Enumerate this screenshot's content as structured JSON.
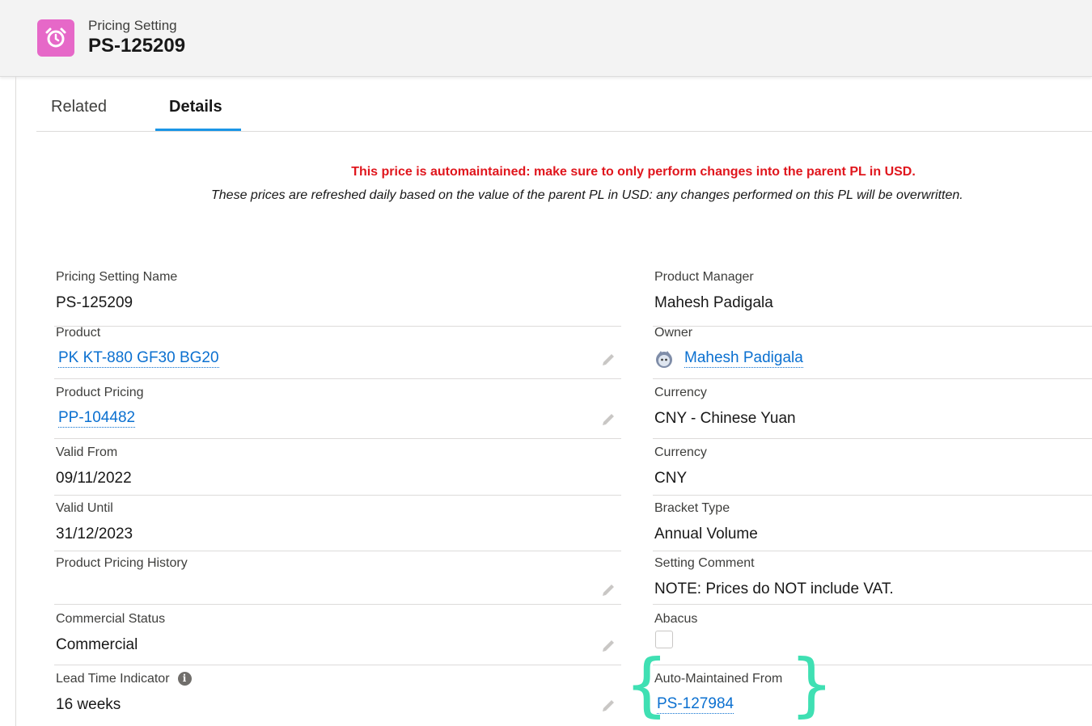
{
  "header": {
    "object_type": "Pricing Setting",
    "record_name": "PS-125209",
    "icon": "alarm-clock-icon",
    "icon_color": "#e668c8"
  },
  "tabs": [
    {
      "label": "Related",
      "active": false
    },
    {
      "label": "Details",
      "active": true
    }
  ],
  "banner": {
    "warning": "This price is automaintained: make sure to only perform changes into the parent PL in USD.",
    "note": "These prices are refreshed daily based on the value of the parent PL in USD: any changes performed on this PL will be overwritten.",
    "warning_color": "#e0161d"
  },
  "fields_left": [
    {
      "label": "Pricing Setting Name",
      "value": "PS-125209"
    },
    {
      "label": "Product",
      "value": "PK KT-880 GF30 BG20"
    },
    {
      "label": "Product Pricing",
      "value": "PP-104482"
    },
    {
      "label": "Valid From",
      "value": "09/11/2022"
    },
    {
      "label": "Valid Until",
      "value": "31/12/2023"
    },
    {
      "label": "Product Pricing History",
      "value": ""
    },
    {
      "label": "Commercial Status",
      "value": "Commercial"
    },
    {
      "label": "Lead Time Indicator",
      "value": "16 weeks"
    }
  ],
  "fields_right": [
    {
      "label": "Product Manager",
      "value": "Mahesh Padigala"
    },
    {
      "label": "Owner",
      "value": "Mahesh Padigala"
    },
    {
      "label": "Currency",
      "value": "CNY - Chinese Yuan"
    },
    {
      "label": "Currency",
      "value": "CNY"
    },
    {
      "label": "Bracket Type",
      "value": "Annual Volume"
    },
    {
      "label": "Setting Comment",
      "value": "NOTE: Prices do NOT include VAT."
    },
    {
      "label": "Abacus",
      "checked": false
    },
    {
      "label": "Auto-Maintained From",
      "value": "PS-127984"
    }
  ],
  "link_color": "#0b70d0",
  "annotation_color": "#3fe0b3"
}
